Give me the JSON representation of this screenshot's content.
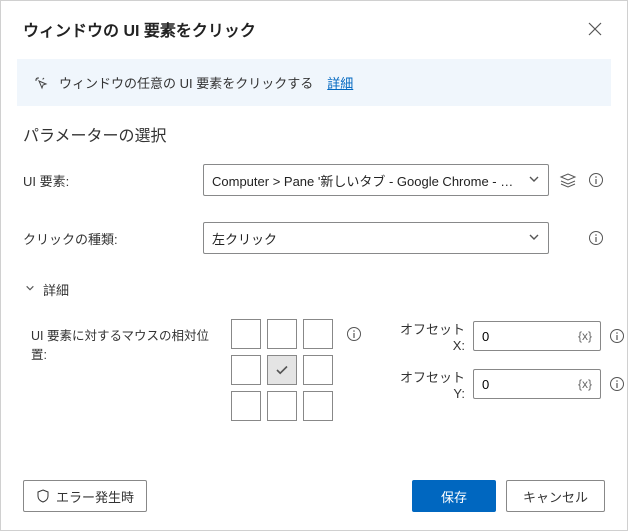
{
  "dialog": {
    "title": "ウィンドウの UI 要素をクリック",
    "banner_text": "ウィンドウの任意の UI 要素をクリックする",
    "banner_link": "詳細"
  },
  "section": {
    "params_title": "パラメーターの選択"
  },
  "fields": {
    "ui_element_label": "UI 要素:",
    "ui_element_value": "Computer > Pane '新しいタブ - Google Chrome - 丈裕 (su",
    "click_type_label": "クリックの種類:",
    "click_type_value": "左クリック",
    "details_label": "詳細",
    "relative_pos_label": "UI 要素に対するマウスの相対位置:",
    "offset_x_label": "オフセット X:",
    "offset_x_value": "0",
    "offset_y_label": "オフセット Y:",
    "offset_y_value": "0"
  },
  "footer": {
    "on_error": "エラー発生時",
    "save": "保存",
    "cancel": "キャンセル"
  }
}
